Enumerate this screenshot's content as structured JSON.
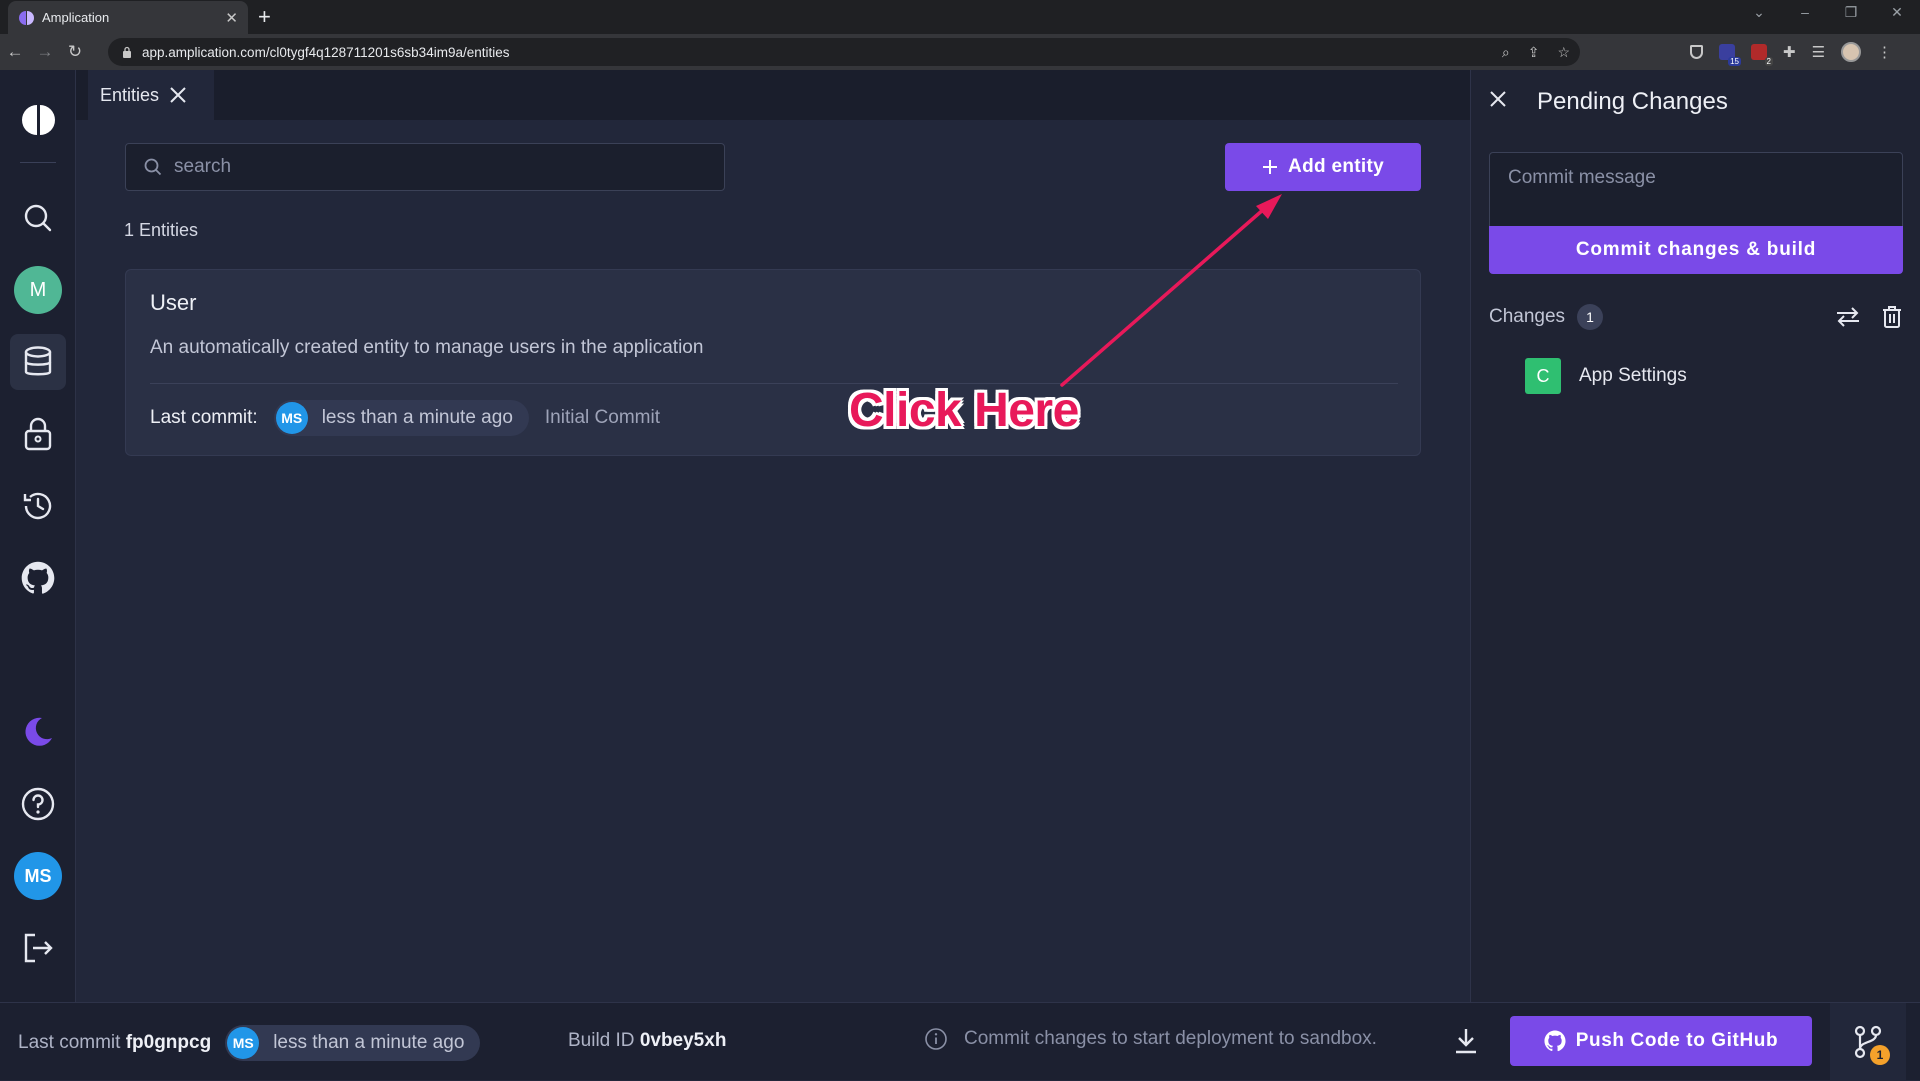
{
  "browser": {
    "tab_title": "Amplication",
    "url": "app.amplication.com/cl0tygf4q128711201s6sb34im9a/entities",
    "ext_badge_1": "15",
    "ext_badge_2": "2"
  },
  "sidebar": {
    "workspace_initial": "M",
    "user_initials": "MS"
  },
  "page": {
    "tab_label": "Entities",
    "search_placeholder": "search",
    "add_entity_label": "Add entity",
    "count_label": "1 Entities"
  },
  "entities": [
    {
      "name": "User",
      "description": "An automatically created entity to manage users in the application",
      "last_commit_label": "Last commit:",
      "author_initials": "MS",
      "time": "less than a minute ago",
      "commit_message": "Initial Commit"
    }
  ],
  "annotation": {
    "text": "Click Here",
    "color": "#e8195a"
  },
  "pending_changes": {
    "title": "Pending Changes",
    "commit_placeholder": "Commit message",
    "commit_button": "Commit changes & build",
    "changes_label": "Changes",
    "changes_count": "1",
    "items": [
      {
        "badge": "C",
        "label": "App Settings"
      }
    ]
  },
  "footer": {
    "last_commit_label": "Last commit",
    "last_commit_id": "fp0gnpcg",
    "author_initials": "MS",
    "time": "less than a minute ago",
    "build_label": "Build ID",
    "build_id": "0vbey5xh",
    "info_text": "Commit changes to start deployment to sandbox.",
    "push_button": "Push Code to GitHub",
    "git_badge": "1"
  },
  "colors": {
    "accent": "#7a4ae8",
    "background": "#22273a",
    "sidebar": "#1c2030",
    "create_badge": "#2fbf71"
  }
}
